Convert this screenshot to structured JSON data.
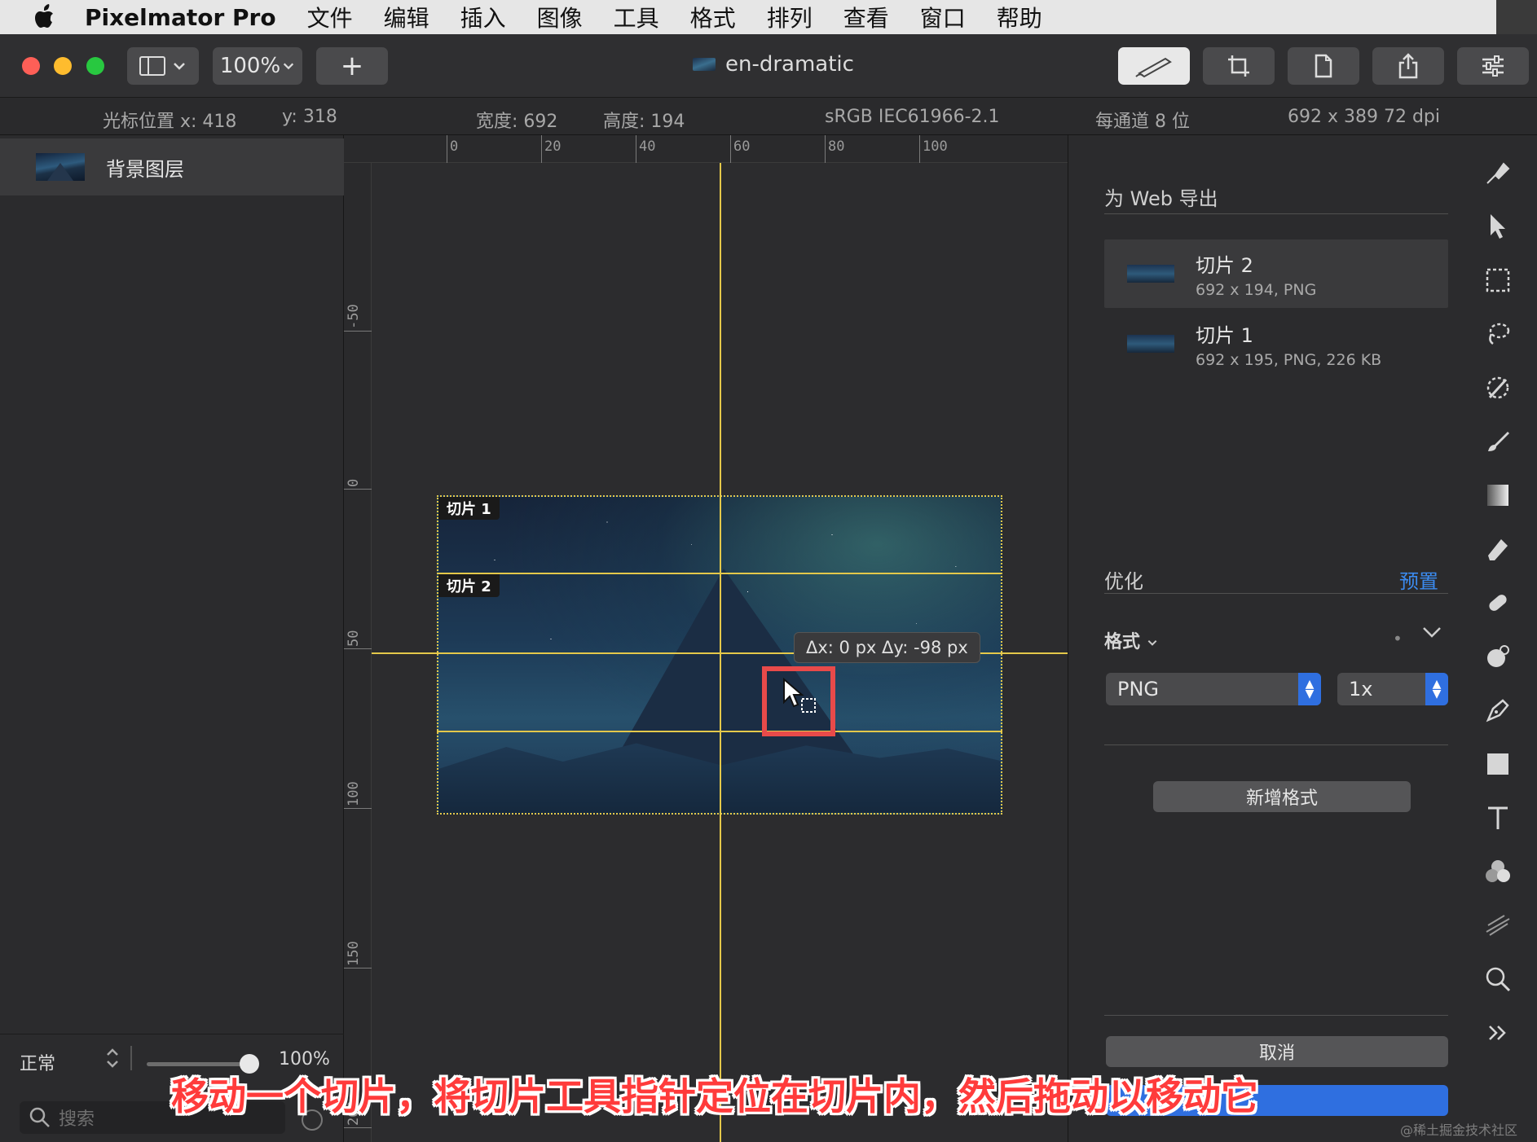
{
  "menubar": {
    "app_name": "Pixelmator Pro",
    "items": [
      "文件",
      "编辑",
      "插入",
      "图像",
      "工具",
      "格式",
      "排列",
      "查看",
      "窗口",
      "帮助"
    ]
  },
  "toolbar": {
    "zoom": "100%",
    "add": "+",
    "document_title": "en-dramatic"
  },
  "infobar": {
    "cursor_x": "光标位置 x:  418",
    "cursor_y": "y:  318",
    "width": "宽度:  692",
    "height": "高度:  194",
    "color_profile": "sRGB IEC61966-2.1",
    "bit_depth": "每通道 8 位",
    "image_size": "692 x 389 72 dpi"
  },
  "layers": {
    "items": [
      {
        "name": "背景图层"
      }
    ],
    "blend_mode": "正常",
    "opacity": "100%",
    "search_placeholder": "搜索"
  },
  "rulers": {
    "top": [
      "0",
      "20",
      "40",
      "60",
      "80",
      "100"
    ],
    "left": [
      "-50",
      "0",
      "50",
      "100",
      "150",
      "200"
    ]
  },
  "canvas": {
    "slice1_tag": "切片 1",
    "slice2_tag": "切片 2",
    "tooltip": "Δx: 0 px  Δy: -98 px"
  },
  "export_panel": {
    "heading": "为 Web 导出",
    "slices": [
      {
        "title": "切片 2",
        "meta": "692 x 194, PNG"
      },
      {
        "title": "切片 1",
        "meta": "692 x 195, PNG, 226 KB"
      }
    ],
    "optimize_label": "优化",
    "preset_link": "预置",
    "format_label": "格式",
    "format_value": "PNG",
    "scale_value": "1x",
    "add_format_button": "新增格式",
    "cancel_button": "取消"
  },
  "caption": "移动一个切片，将切片工具指针定位在切片内，然后拖动以移动它",
  "watermark": "@稀土掘金技术社区",
  "colors": {
    "guide": "#e4c84a",
    "accent_blue": "#2f6fe0",
    "highlight_red": "#e84a4a"
  },
  "icons": [
    "apple-icon",
    "sidebar-toggle-icon",
    "chevron-down-icon",
    "paint-icon",
    "crop-icon",
    "document-icon",
    "share-icon",
    "adjust-icon",
    "style-brush-icon",
    "arrow-select-icon",
    "marquee-icon",
    "lasso-icon",
    "magic-wand-icon",
    "paint-brush-icon",
    "gradient-icon",
    "eraser-icon",
    "repair-icon",
    "effects-icon",
    "pen-icon",
    "shape-icon",
    "type-icon",
    "color-adjust-icon",
    "distort-icon",
    "zoom-icon",
    "more-tools-icon"
  ]
}
